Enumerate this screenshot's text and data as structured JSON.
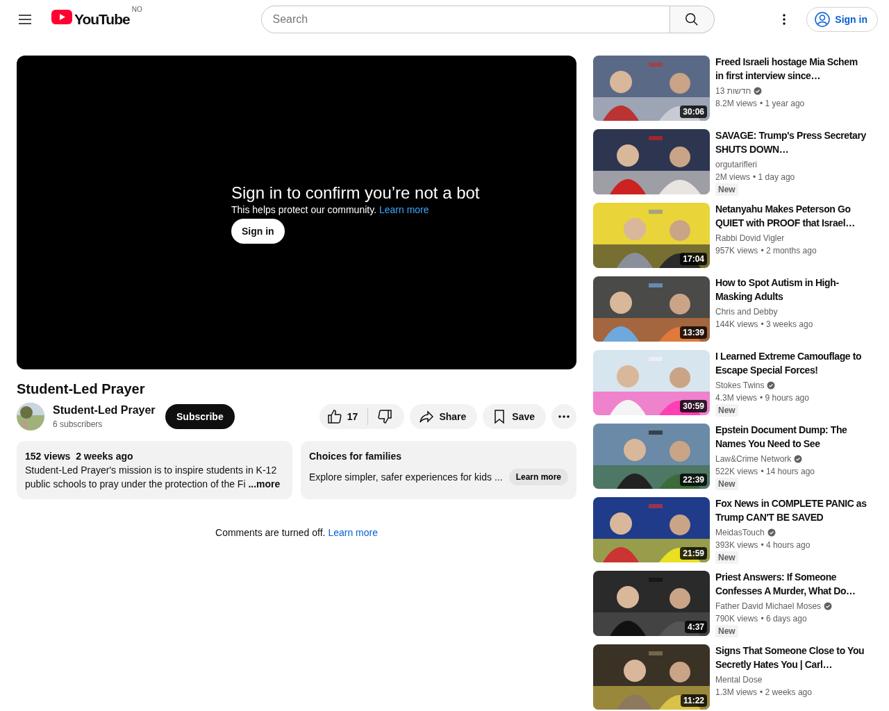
{
  "header": {
    "logo": "YouTube",
    "country": "NO",
    "search": {
      "placeholder": "Search"
    },
    "sign_in": "Sign in"
  },
  "player": {
    "heading": "Sign in to confirm you’re not a bot",
    "subtext": "This helps protect our community.",
    "link": "Learn more",
    "button": "Sign in"
  },
  "video": {
    "title": "Student-Led Prayer",
    "channel": "Student-Led Prayer",
    "subscribers": "6 subscribers",
    "subscribe": "Subscribe",
    "likes": "17",
    "share": "Share",
    "save": "Save"
  },
  "description": {
    "views": "152 views",
    "date": "2 weeks ago",
    "text": "Student-Led Prayer's mission is to inspire students in K-12 public schools to pray under the protection of the Fi",
    "more": "...more"
  },
  "promo": {
    "title": "Choices for families",
    "text": "Explore simpler, safer experiences for kids ...",
    "button": "Learn more"
  },
  "comments": {
    "text": "Comments are turned off.",
    "link": "Learn more"
  },
  "meta_separator": "•",
  "recommendations": [
    {
      "title": "Freed Israeli hostage Mia Schem in first interview since…",
      "channel": "13 חדשות",
      "verified": true,
      "views": "8.2M views",
      "age": "1 year ago",
      "duration": "30:06"
    },
    {
      "title": "SAVAGE: Trump's Press Secretary SHUTS DOWN…",
      "channel": "orgutarifleri",
      "verified": false,
      "views": "2M views",
      "age": "1 day ago",
      "badge": "New"
    },
    {
      "title": "Netanyahu Makes Peterson Go QUIET with PROOF that Israel…",
      "channel": "Rabbi Dovid Vigler",
      "verified": false,
      "views": "957K views",
      "age": "2 months ago",
      "duration": "17:04"
    },
    {
      "title": "How to Spot Autism in High-Masking Adults",
      "channel": "Chris and Debby",
      "verified": false,
      "views": "144K views",
      "age": "3 weeks ago",
      "duration": "13:39"
    },
    {
      "title": "I Learned Extreme Camouflage to Escape Special Forces!",
      "channel": "Stokes Twins",
      "verified": true,
      "views": "4.3M views",
      "age": "9 hours ago",
      "duration": "30:59",
      "badge": "New"
    },
    {
      "title": "Epstein Document Dump: The Names You Need to See",
      "channel": "Law&Crime Network",
      "verified": true,
      "views": "522K views",
      "age": "14 hours ago",
      "duration": "22:39",
      "badge": "New"
    },
    {
      "title": "Fox News in COMPLETE PANIC as Trump CAN'T BE SAVED",
      "channel": "MeidasTouch",
      "verified": true,
      "views": "393K views",
      "age": "4 hours ago",
      "duration": "21:59",
      "badge": "New"
    },
    {
      "title": "Priest Answers: If Someone Confesses A Murder, What Do…",
      "channel": "Father David Michael Moses",
      "verified": true,
      "views": "790K views",
      "age": "6 days ago",
      "duration": "4:37",
      "badge": "New"
    },
    {
      "title": "Signs That Someone Close to You Secretly Hates You | Carl…",
      "channel": "Mental Dose",
      "verified": false,
      "views": "1.3M views",
      "age": "2 weeks ago",
      "duration": "11:22"
    }
  ]
}
